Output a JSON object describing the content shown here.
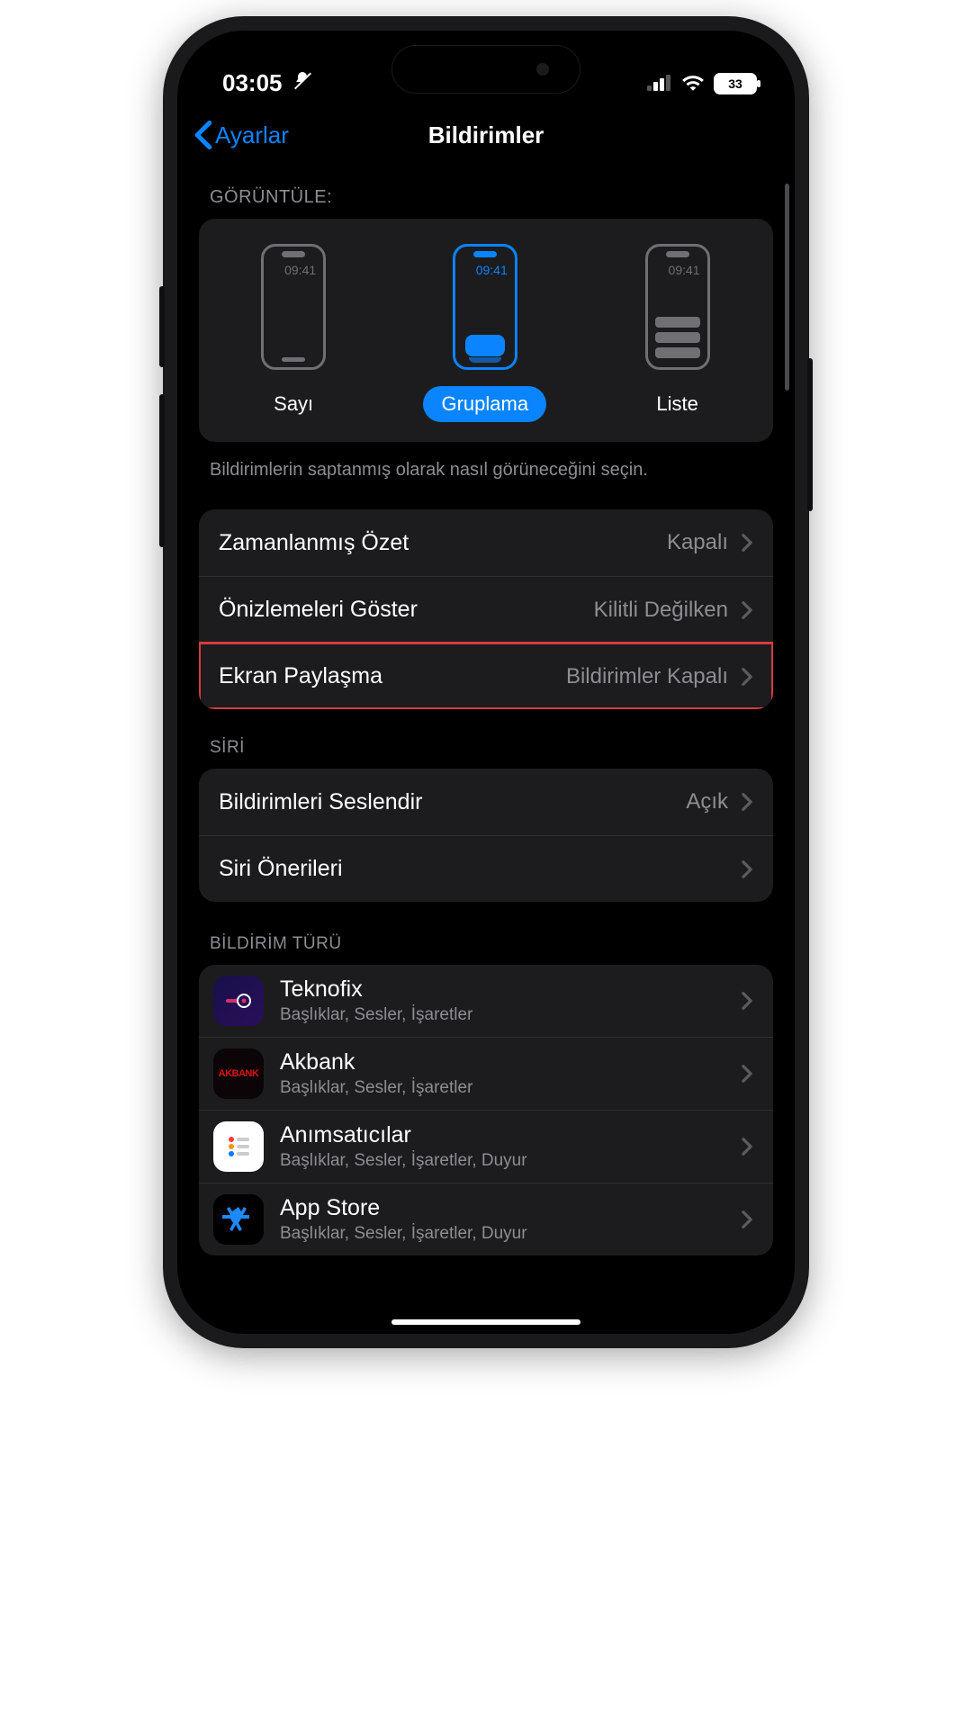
{
  "status": {
    "time": "03:05",
    "battery": "33"
  },
  "nav": {
    "back": "Ayarlar",
    "title": "Bildirimler"
  },
  "display": {
    "header": "GÖRÜNTÜLE:",
    "sampleTime": "09:41",
    "options": {
      "count": "Sayı",
      "stack": "Gruplama",
      "list": "Liste"
    },
    "footer": "Bildirimlerin saptanmış olarak nasıl görüneceğini seçin."
  },
  "group1": {
    "scheduled": {
      "label": "Zamanlanmış Özet",
      "value": "Kapalı"
    },
    "previews": {
      "label": "Önizlemeleri Göster",
      "value": "Kilitli Değilken"
    },
    "sharing": {
      "label": "Ekran Paylaşma",
      "value": "Bildirimler Kapalı"
    }
  },
  "siri": {
    "header": "SİRİ",
    "announce": {
      "label": "Bildirimleri Seslendir",
      "value": "Açık"
    },
    "suggestions": {
      "label": "Siri Önerileri"
    }
  },
  "apps": {
    "header": "BİLDİRİM TÜRÜ",
    "items": [
      {
        "name": "Teknofix",
        "sub": "Başlıklar, Sesler, İşaretler"
      },
      {
        "name": "Akbank",
        "sub": "Başlıklar, Sesler, İşaretler"
      },
      {
        "name": "Anımsatıcılar",
        "sub": "Başlıklar, Sesler, İşaretler, Duyur"
      },
      {
        "name": "App Store",
        "sub": "Başlıklar, Sesler, İşaretler, Duyur"
      }
    ]
  }
}
